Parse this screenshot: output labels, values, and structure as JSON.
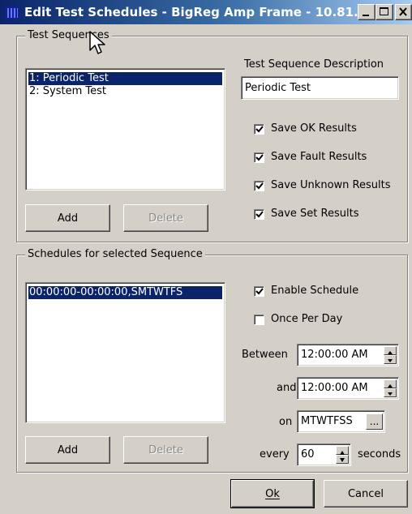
{
  "window": {
    "title": "Edit Test Schedules - BigReg Amp Frame - 10.81..."
  },
  "sequences": {
    "group_label": "Test Sequences",
    "items": [
      "1: Periodic Test",
      "2: System Test"
    ],
    "selected_index": 0,
    "add_label": "Add",
    "delete_label": "Delete",
    "description_label": "Test Sequence Description",
    "description_value": "Periodic Test",
    "options": [
      {
        "label": "Save OK Results",
        "checked": true
      },
      {
        "label": "Save Fault Results",
        "checked": true
      },
      {
        "label": "Save Unknown Results",
        "checked": true
      },
      {
        "label": "Save Set Results",
        "checked": true
      }
    ]
  },
  "schedules": {
    "group_label": "Schedules for selected Sequence",
    "items": [
      "00:00:00-00:00:00,SMTWTFS"
    ],
    "selected_index": 0,
    "add_label": "Add",
    "delete_label": "Delete",
    "enable_label": "Enable Schedule",
    "enable_checked": true,
    "once_label": "Once Per Day",
    "once_checked": false,
    "between_label": "Between",
    "between_value": "12:00:00 AM",
    "and_label": "and",
    "and_value": "12:00:00 AM",
    "on_label": "on",
    "on_value": "MTWTFSS",
    "browse_label": "...",
    "every_label": "every",
    "every_value": "60",
    "seconds_label": "seconds"
  },
  "footer": {
    "ok_label": "Ok",
    "cancel_label": "Cancel"
  },
  "icons": [
    "app-icon",
    "minimize-icon",
    "maximize-icon",
    "close-icon",
    "checkmark-icon",
    "spin-up-icon",
    "spin-down-icon",
    "mouse-cursor-icon"
  ],
  "colors": {
    "title_start": "#0a246a",
    "title_end": "#a6caf0",
    "selection": "#0a246a",
    "face": "#d4d0c8"
  }
}
